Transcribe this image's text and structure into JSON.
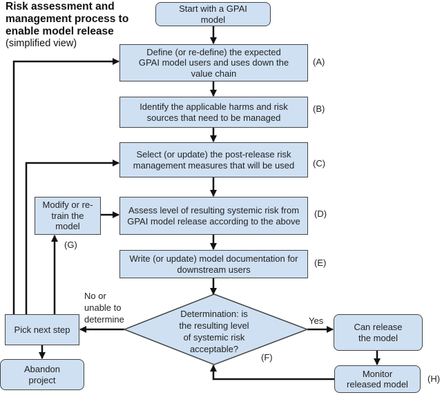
{
  "title": {
    "line1": "Risk assessment and",
    "line2": "management process to",
    "line3": "enable model release",
    "subtitle": "(simplified view)"
  },
  "nodes": {
    "start": {
      "text": "Start with a GPAI model"
    },
    "a": {
      "text": "Define (or re-define) the expected GPAI model users and uses down the value chain",
      "tag": "(A)"
    },
    "b": {
      "text": "Identify the applicable harms and risk sources that need to be managed",
      "tag": "(B)"
    },
    "c": {
      "text": "Select (or update) the post-release risk management measures that will be used",
      "tag": "(C)"
    },
    "d": {
      "text": "Assess level of resulting systemic risk from GPAI model release according to the above",
      "tag": "(D)"
    },
    "e": {
      "text": "Write (or update) model documentation for downstream users",
      "tag": "(E)"
    },
    "f": {
      "line1": "Determination: is",
      "line2": "the resulting level",
      "line3": "of systemic risk",
      "line4": "acceptable?",
      "tag": "(F)"
    },
    "g": {
      "text": "Modify or re-train the model",
      "tag": "(G)"
    },
    "pick": {
      "text": "Pick next step"
    },
    "abandon": {
      "text": "Abandon project"
    },
    "release": {
      "text": "Can release the model"
    },
    "monitor": {
      "text": "Monitor released model",
      "tag": "(H)"
    }
  },
  "edges": {
    "no_label_1": "No or",
    "no_label_2": "unable to",
    "no_label_3": "determine",
    "yes_label": "Yes"
  },
  "colors": {
    "box_fill": "#cfe0f2",
    "box_border": "#444444",
    "line": "#111111"
  }
}
